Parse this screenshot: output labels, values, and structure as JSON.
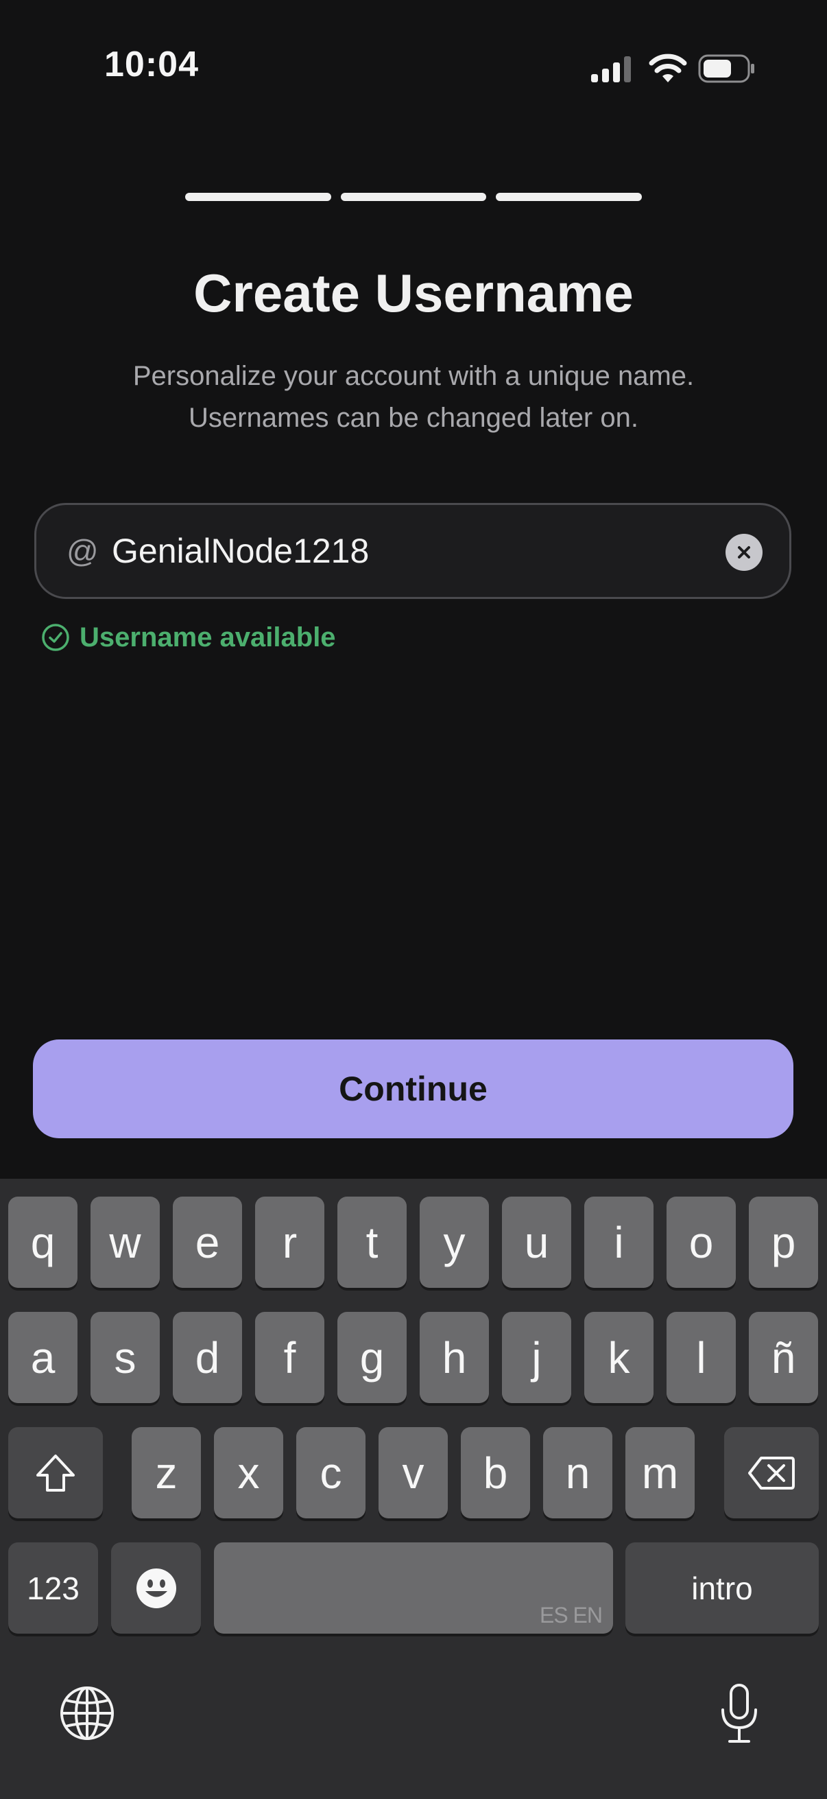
{
  "status_bar": {
    "time": "10:04",
    "icons": [
      "cellular-signal-icon",
      "wifi-icon",
      "battery-icon"
    ]
  },
  "progress": {
    "steps_total": 3,
    "steps_filled": 3
  },
  "header": {
    "title": "Create Username",
    "subtitle_line1": "Personalize your account with a unique name.",
    "subtitle_line2": "Usernames can be changed later on."
  },
  "username_field": {
    "prefix": "@",
    "value": "GenialNode1218",
    "clear_icon": "clear-icon"
  },
  "availability": {
    "text": "Username available",
    "color": "#4caf6e",
    "icon": "check-circle-icon"
  },
  "continue_button": {
    "label": "Continue",
    "color": "#a89fee"
  },
  "keyboard": {
    "row1": [
      "q",
      "w",
      "e",
      "r",
      "t",
      "y",
      "u",
      "i",
      "o",
      "p"
    ],
    "row2": [
      "a",
      "s",
      "d",
      "f",
      "g",
      "h",
      "j",
      "k",
      "l",
      "ñ"
    ],
    "row3": [
      "z",
      "x",
      "c",
      "v",
      "b",
      "n",
      "m"
    ],
    "numbers_label": "123",
    "space_hint": "ES EN",
    "return_label": "intro",
    "icons": [
      "shift-icon",
      "backspace-icon",
      "emoji-icon",
      "globe-icon",
      "microphone-icon"
    ]
  }
}
